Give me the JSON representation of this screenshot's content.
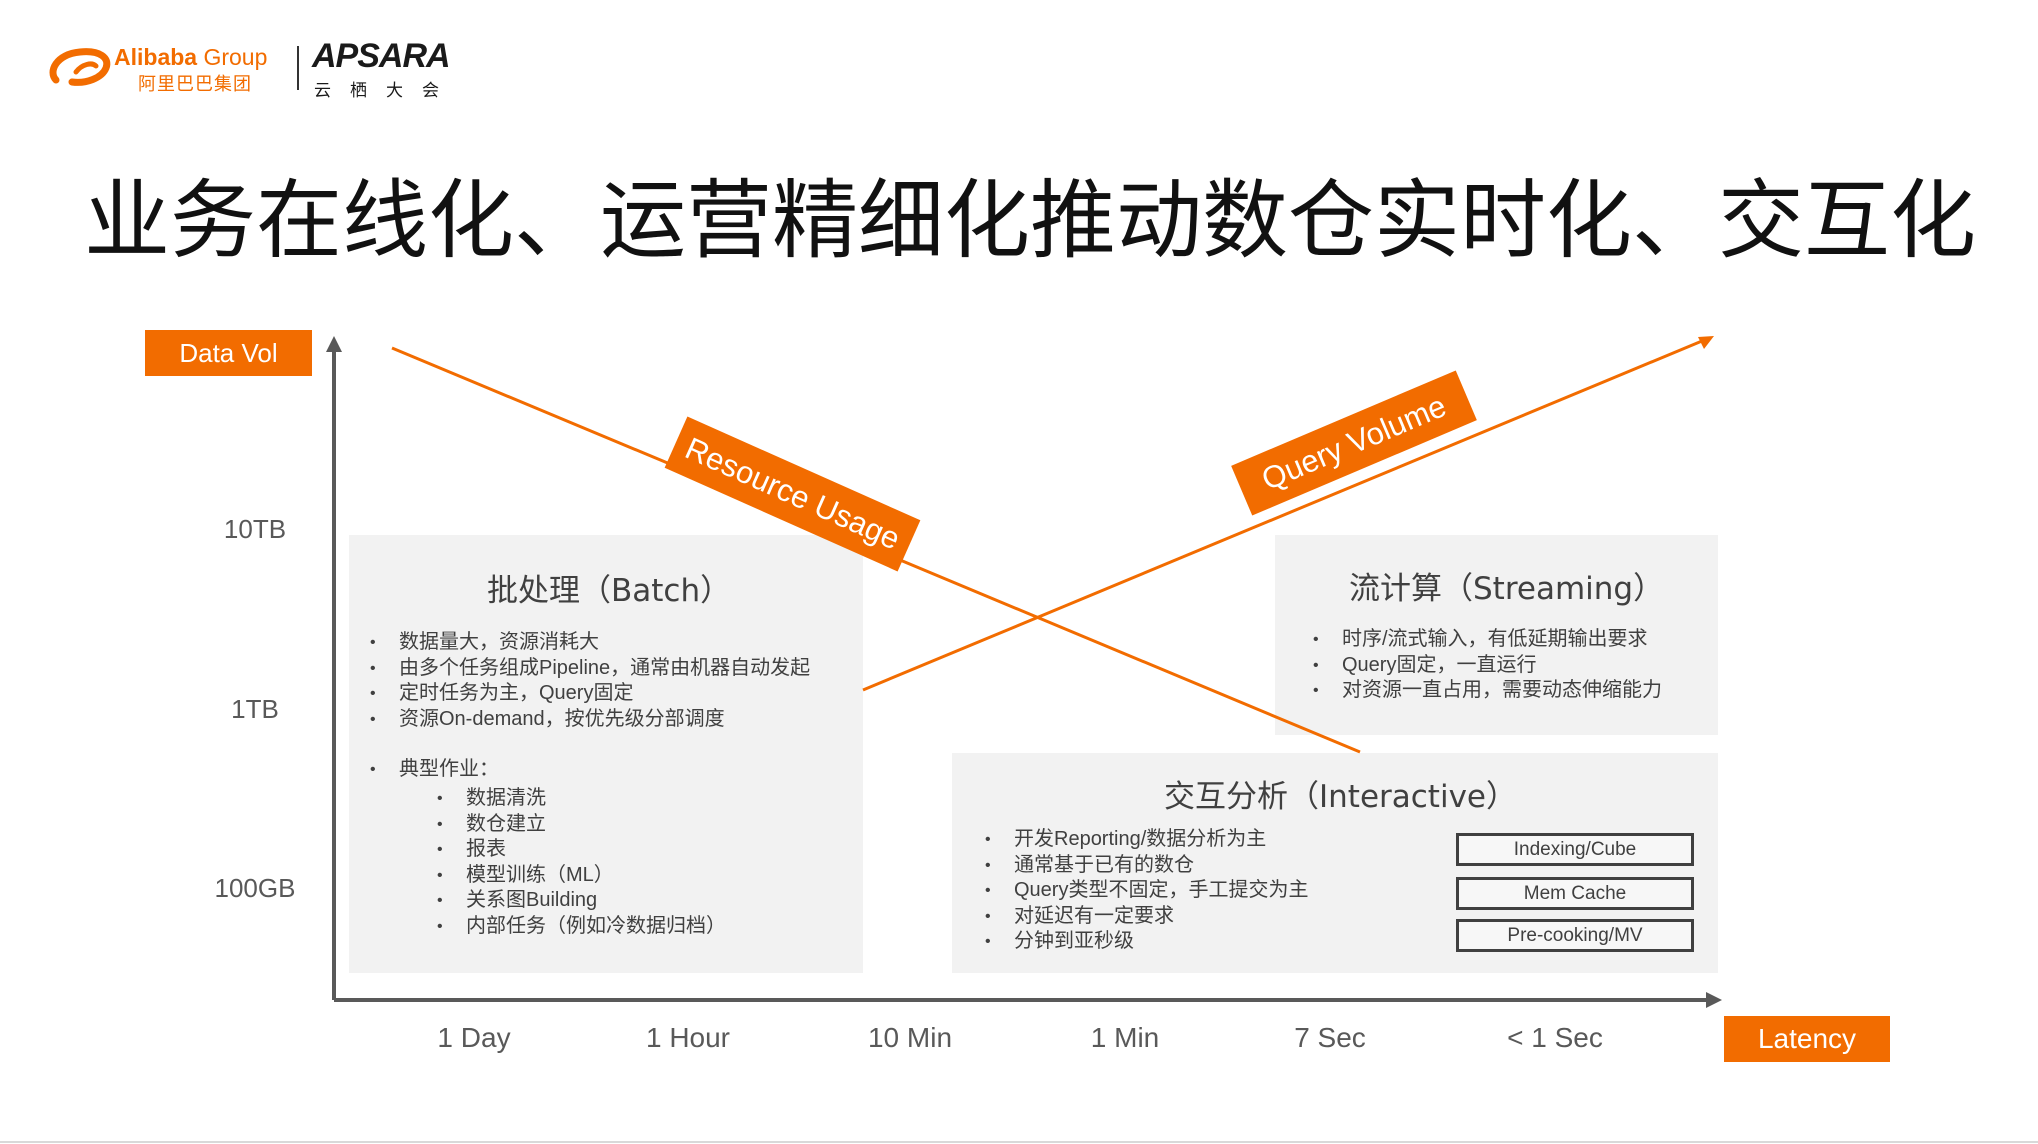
{
  "logo": {
    "alibaba": "Alibaba",
    "group": "Group",
    "alibaba_cn": "阿里巴巴集团",
    "apsara": "APSARA",
    "apsara_cn": "云栖大会"
  },
  "title": "业务在线化、运营精细化推动数仓实时化、交互化",
  "axes": {
    "y_label": "Data Vol",
    "x_label": "Latency",
    "y_ticks": [
      "10TB",
      "1TB",
      "100GB"
    ],
    "x_ticks": [
      "1 Day",
      "1 Hour",
      "10 Min",
      "1 Min",
      "7 Sec",
      "< 1 Sec"
    ]
  },
  "trend_labels": {
    "resource_usage": "Resource Usage",
    "query_volume": "Query Volume"
  },
  "batch": {
    "title": "批处理（Batch）",
    "items": [
      "数据量大，资源消耗大",
      "由多个任务组成Pipeline，通常由机器自动发起",
      "定时任务为主，Query固定",
      "资源On-demand，按优先级分部调度"
    ],
    "typical_label": "典型作业：",
    "typical_items": [
      "数据清洗",
      "数仓建立",
      "报表",
      "模型训练（ML）",
      "关系图Building",
      "内部任务（例如冷数据归档）"
    ]
  },
  "streaming": {
    "title": "流计算（Streaming）",
    "items": [
      "时序/流式输入，有低延期输出要求",
      "Query固定，一直运行",
      "对资源一直占用，需要动态伸缩能力"
    ]
  },
  "interactive": {
    "title": "交互分析（Interactive）",
    "items": [
      "开发Reporting/数据分析为主",
      "通常基于已有的数仓",
      "Query类型不固定，手工提交为主",
      "对延迟有一定要求",
      "分钟到亚秒级"
    ],
    "chips": [
      "Indexing/Cube",
      "Mem Cache",
      "Pre-cooking/MV"
    ]
  },
  "colors": {
    "accent": "#f26c00",
    "axis": "#595959",
    "panel": "#f2f2f2"
  }
}
